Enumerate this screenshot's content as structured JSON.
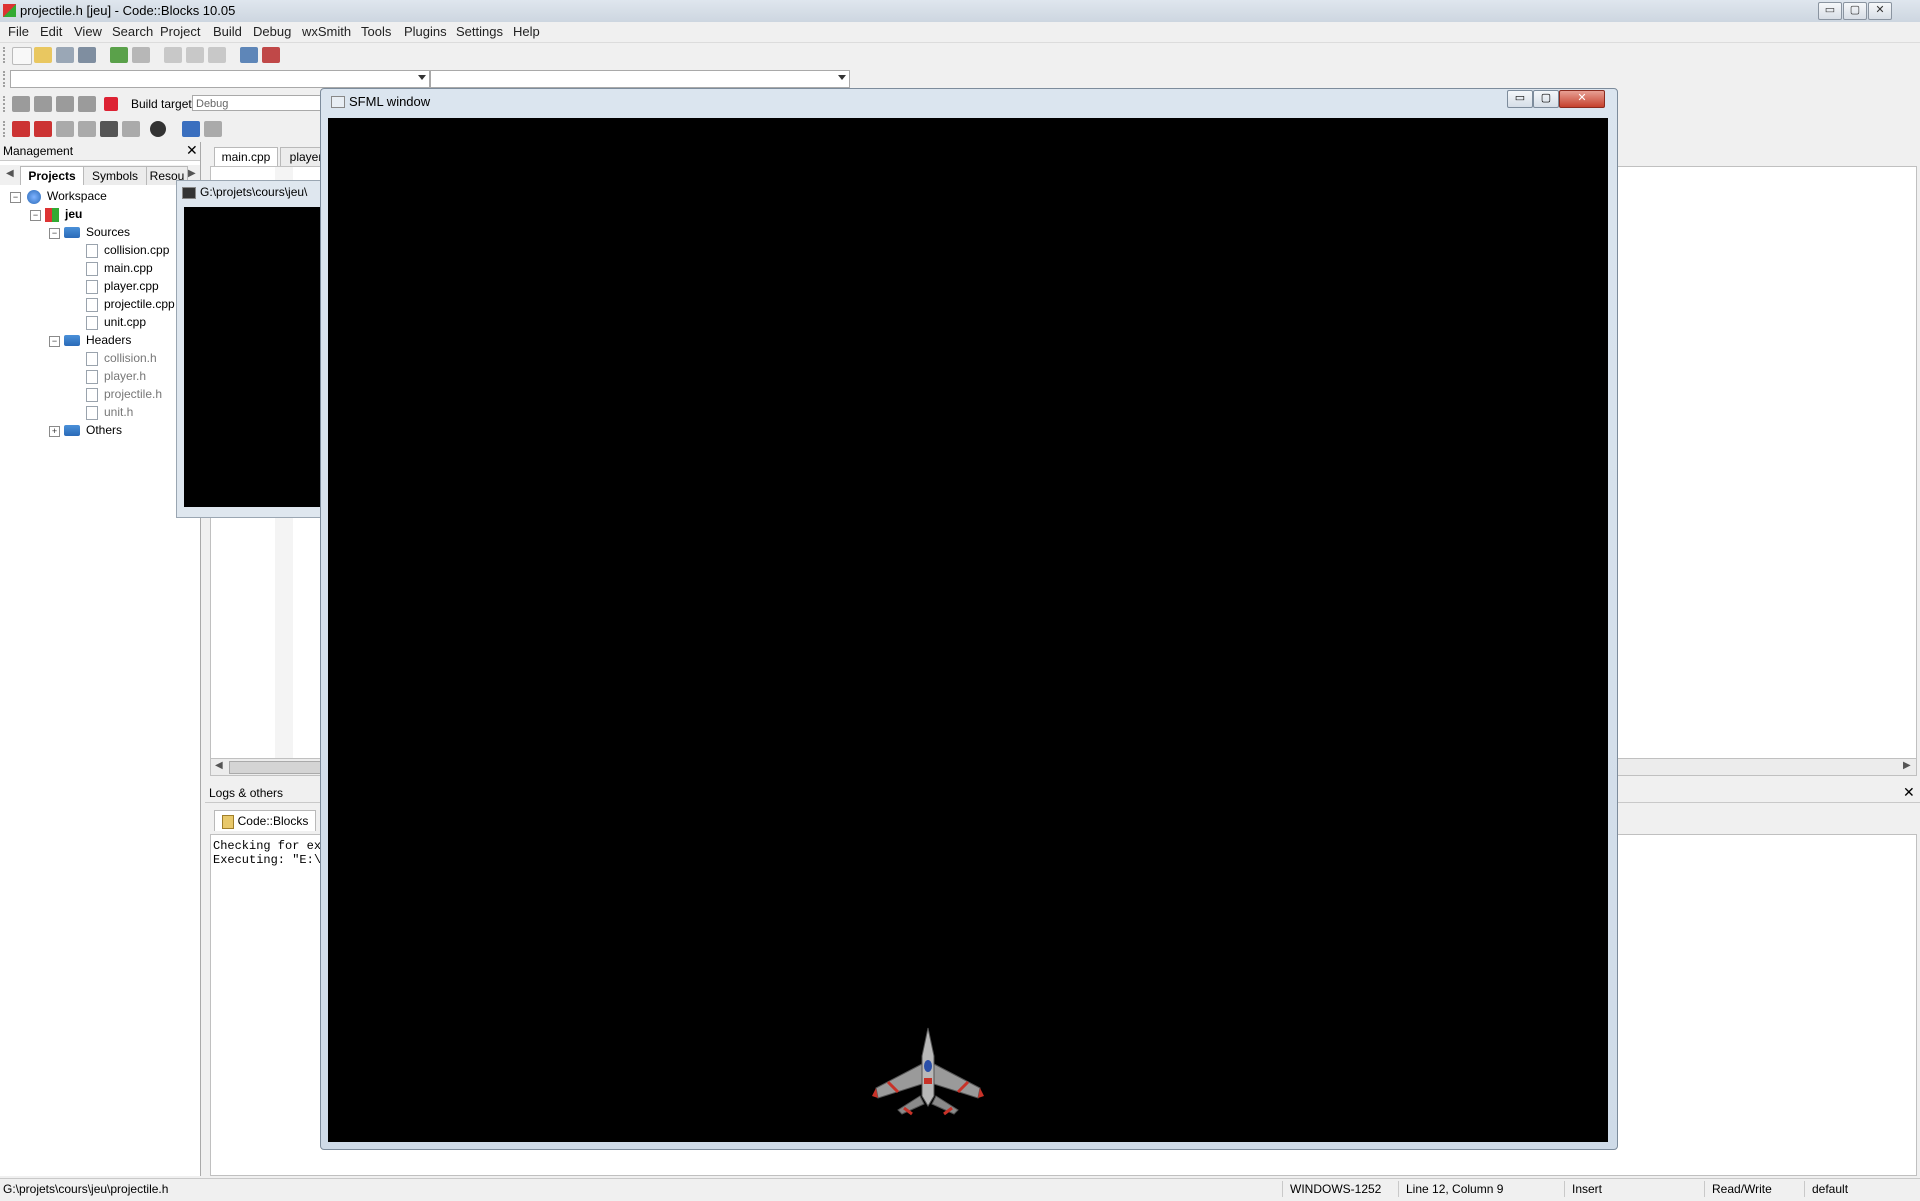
{
  "app": {
    "title": "projectile.h [jeu] - Code::Blocks 10.05"
  },
  "window_controls": {
    "minimize": "▭",
    "maximize": "▢",
    "close": "✕"
  },
  "menu": [
    "File",
    "Edit",
    "View",
    "Search",
    "Project",
    "Build",
    "Debug",
    "wxSmith",
    "Tools",
    "Plugins",
    "Settings",
    "Help"
  ],
  "build": {
    "target_label": "Build target:",
    "target_value": "Debug"
  },
  "management": {
    "title": "Management",
    "tabs": [
      "Projects",
      "Symbols",
      "Resou"
    ],
    "tree": {
      "workspace": "Workspace",
      "project": "jeu",
      "sources_label": "Sources",
      "sources": [
        "collision.cpp",
        "main.cpp",
        "player.cpp",
        "projectile.cpp",
        "unit.cpp"
      ],
      "headers_label": "Headers",
      "headers": [
        "collision.h",
        "player.h",
        "projectile.h",
        "unit.h"
      ],
      "others_label": "Others"
    }
  },
  "editor": {
    "tabs": [
      "main.cpp",
      "player"
    ]
  },
  "logs": {
    "title": "Logs & others",
    "tab": "Code::Blocks",
    "lines": [
      "Checking for ex",
      "Executing: \"E:\\"
    ]
  },
  "console": {
    "title": "G:\\projets\\cours\\jeu\\"
  },
  "sfml": {
    "title": "SFML window"
  },
  "statusbar": {
    "path": "G:\\projets\\cours\\jeu\\projectile.h",
    "encoding": "WINDOWS-1252",
    "position": "Line 12, Column 9",
    "mode": "Insert",
    "access": "Read/Write",
    "lang": "default"
  },
  "colors": {
    "accent": "#2a6ab8",
    "canvas": "#000000"
  },
  "icons": [
    "app-icon",
    "new-file-icon",
    "open-icon",
    "save-icon",
    "save-all-icon",
    "undo-icon",
    "redo-icon",
    "cut-icon",
    "copy-icon",
    "paste-icon",
    "find-icon",
    "replace-icon",
    "settings-icon",
    "run-icon",
    "build-run-icon",
    "rebuild-icon",
    "stop-build-icon",
    "close-panel-icon",
    "ship-sprite"
  ]
}
